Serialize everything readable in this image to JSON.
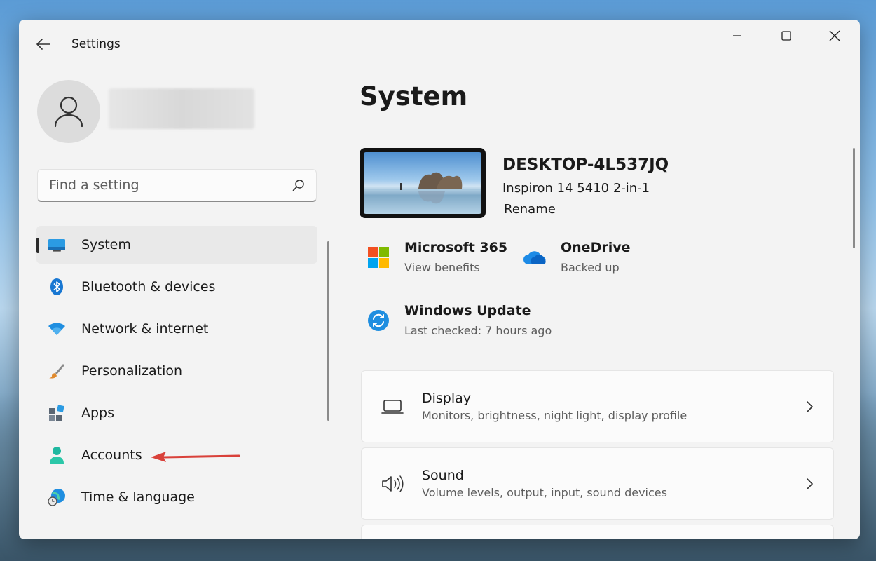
{
  "window": {
    "title": "Settings"
  },
  "search": {
    "placeholder": "Find a setting"
  },
  "sidebar": {
    "items": [
      {
        "label": "System",
        "icon": "monitor-icon",
        "active": true
      },
      {
        "label": "Bluetooth & devices",
        "icon": "bluetooth-icon"
      },
      {
        "label": "Network & internet",
        "icon": "wifi-icon"
      },
      {
        "label": "Personalization",
        "icon": "brush-icon"
      },
      {
        "label": "Apps",
        "icon": "apps-icon"
      },
      {
        "label": "Accounts",
        "icon": "person-icon"
      },
      {
        "label": "Time & language",
        "icon": "globe-clock-icon"
      }
    ]
  },
  "main": {
    "title": "System",
    "device": {
      "name": "DESKTOP-4L537JQ",
      "model": "Inspiron 14 5410 2-in-1",
      "rename": "Rename"
    },
    "tiles": [
      {
        "title": "Microsoft 365",
        "sub": "View benefits",
        "icon": "microsoft-logo-icon"
      },
      {
        "title": "OneDrive",
        "sub": "Backed up",
        "icon": "cloud-icon"
      },
      {
        "title": "Windows Update",
        "sub": "Last checked: 7 hours ago",
        "icon": "update-icon"
      }
    ],
    "cards": [
      {
        "title": "Display",
        "sub": "Monitors, brightness, night light, display profile",
        "icon": "laptop-icon"
      },
      {
        "title": "Sound",
        "sub": "Volume levels, output, input, sound devices",
        "icon": "speaker-icon"
      }
    ]
  },
  "colors": {
    "accent": "#0067c0",
    "annotation_arrow": "#d9413a",
    "window_bg": "#f3f3f3"
  }
}
